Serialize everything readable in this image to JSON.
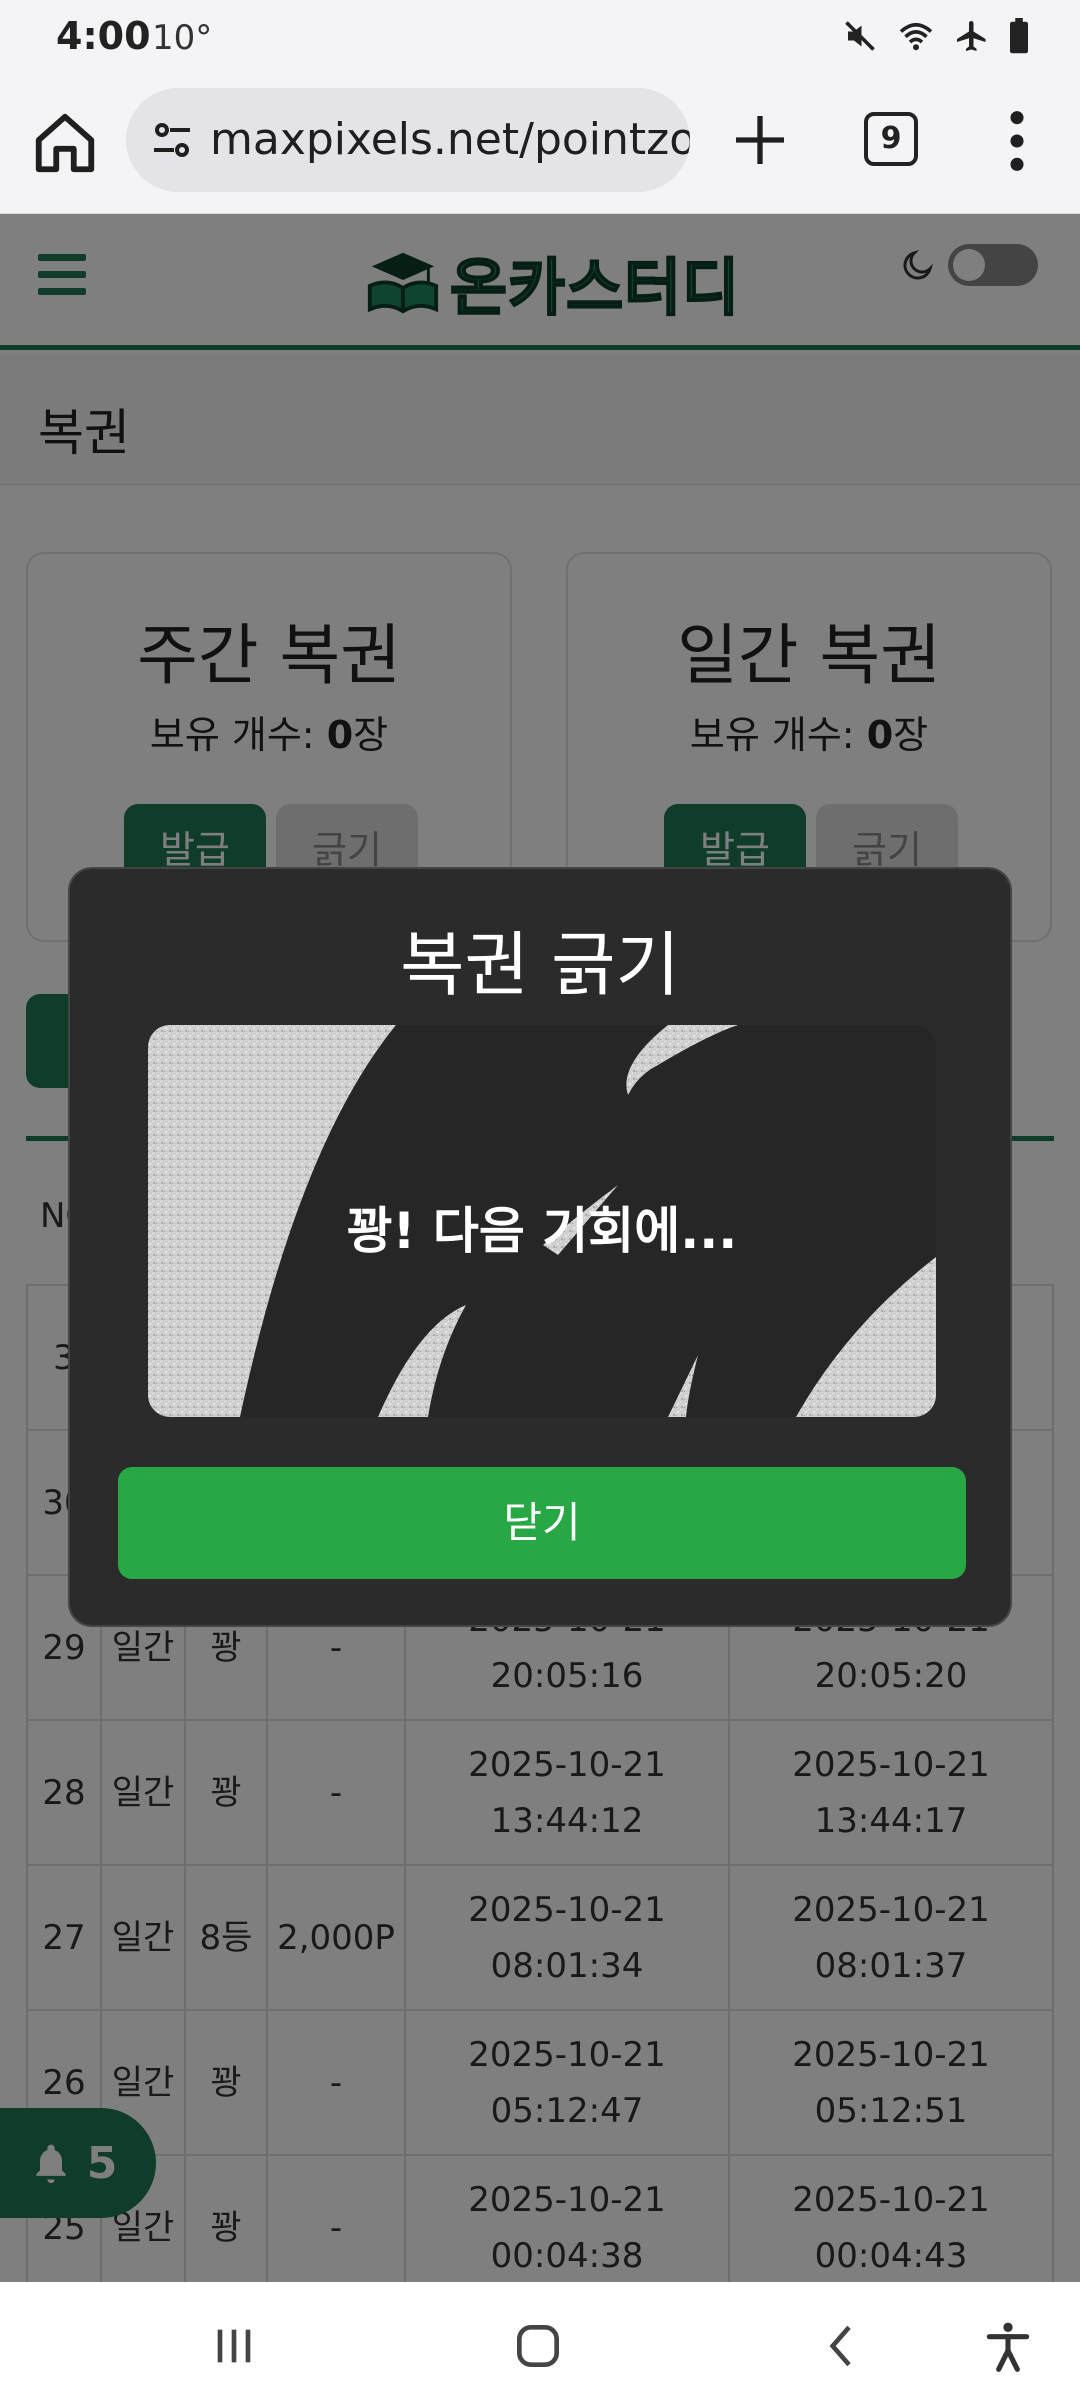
{
  "status_bar": {
    "time": "4:00",
    "temperature": "10°",
    "icons": [
      "mute-icon",
      "wifi-icon",
      "airplane-icon",
      "battery-icon"
    ]
  },
  "browser": {
    "url": "maxpixels.net/pointzo",
    "tab_count": "9"
  },
  "site": {
    "logo_text": "온카스터디",
    "section_title": "복권",
    "brand_color": "#1f7a54"
  },
  "cards": [
    {
      "title": "주간 복권",
      "count_label": "보유 개수: ",
      "count_value": "0",
      "count_unit": "장",
      "issue_label": "발급",
      "scratch_label": "긁기"
    },
    {
      "title": "일간 복권",
      "count_label": "보유 개수: ",
      "count_value": "0",
      "count_unit": "장",
      "issue_label": "발급",
      "scratch_label": "긁기"
    }
  ],
  "table": {
    "partial_header": "NO",
    "rows": [
      {
        "no": "3",
        "type": "",
        "result": "",
        "prize": "",
        "issued": "",
        "scratched": ""
      },
      {
        "no": "30",
        "type": "",
        "result": "",
        "prize": "",
        "issued": "",
        "scratched": ""
      },
      {
        "no": "29",
        "type": "일간",
        "result": "꽝",
        "prize": "-",
        "issued_date": "2025-10-21",
        "issued_time": "20:05:16",
        "scratched_date": "2025-10-21",
        "scratched_time": "20:05:20"
      },
      {
        "no": "28",
        "type": "일간",
        "result": "꽝",
        "prize": "-",
        "issued_date": "2025-10-21",
        "issued_time": "13:44:12",
        "scratched_date": "2025-10-21",
        "scratched_time": "13:44:17"
      },
      {
        "no": "27",
        "type": "일간",
        "result": "8등",
        "prize": "2,000P",
        "issued_date": "2025-10-21",
        "issued_time": "08:01:34",
        "scratched_date": "2025-10-21",
        "scratched_time": "08:01:37"
      },
      {
        "no": "26",
        "type": "일간",
        "result": "꽝",
        "prize": "-",
        "issued_date": "2025-10-21",
        "issued_time": "05:12:47",
        "scratched_date": "2025-10-21",
        "scratched_time": "05:12:51"
      },
      {
        "no": "25",
        "type": "일간",
        "result": "꽝",
        "prize": "-",
        "issued_date": "2025-10-21",
        "issued_time": "00:04:38",
        "scratched_date": "2025-10-21",
        "scratched_time": "00:04:43"
      }
    ]
  },
  "notification_fab": {
    "count": "5"
  },
  "modal": {
    "title": "복권 긁기",
    "result_text": "꽝! 다음 기회에...",
    "close_label": "닫기",
    "close_color": "#28a745"
  }
}
